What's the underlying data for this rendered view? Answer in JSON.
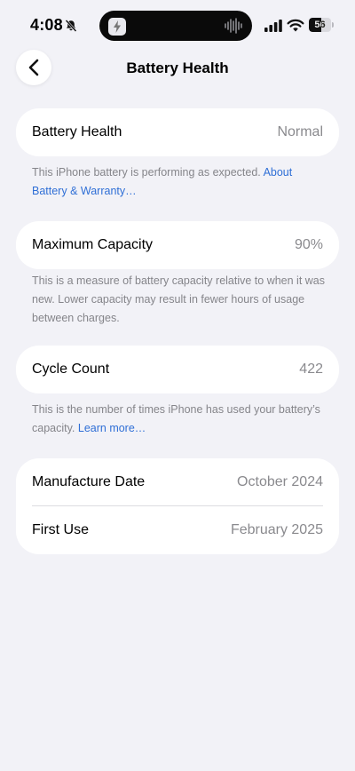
{
  "status_bar": {
    "time": "4:08",
    "battery_level": "56",
    "battery_fraction": 0.56,
    "icons": [
      "bell-slash-icon",
      "lightning-app-icon",
      "audio-waveform-icon",
      "cellular-signal-icon",
      "wifi-icon",
      "battery-icon"
    ]
  },
  "nav": {
    "back_icon": "chevron-left-icon",
    "title": "Battery Health"
  },
  "battery_health": {
    "label": "Battery Health",
    "value": "Normal",
    "footnote_text": "This iPhone battery is performing as expected. ",
    "footnote_link": "About Battery & Warranty…"
  },
  "maximum_capacity": {
    "label": "Maximum Capacity",
    "value": "90%",
    "footnote_text": "This is a measure of battery capacity relative to when it was new. Lower capacity may result in fewer hours of usage between charges."
  },
  "cycle_count": {
    "label": "Cycle Count",
    "value": "422",
    "footnote_text": "This is the number of times iPhone has used your battery’s capacity. ",
    "footnote_link": "Learn more…"
  },
  "dates": {
    "manufacture_label": "Manufacture Date",
    "manufacture_value": "October 2024",
    "first_use_label": "First Use",
    "first_use_value": "February 2025"
  },
  "colors": {
    "background": "#f2f2f7",
    "card": "#ffffff",
    "link": "#2f6fd6",
    "secondary_text": "#8a8a8e"
  }
}
